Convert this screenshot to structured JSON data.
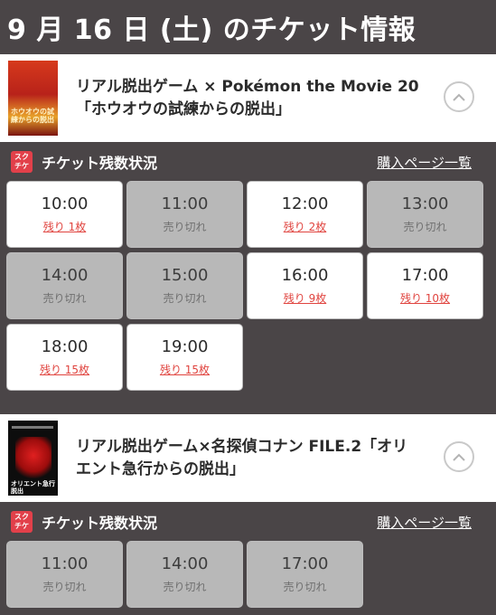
{
  "page": {
    "title": "9 月 16 日 (土) のチケット情報"
  },
  "events": [
    {
      "title": "リアル脱出ゲーム × Pokémon the Movie 20「ホウオウの試練からの脱出」",
      "poster_text": "ホウオウの試練からの脱出",
      "status_title": "チケット残数状況",
      "purchase_link": "購入ページ一覧",
      "slots": [
        {
          "time": "10:00",
          "status": "残り 1枚",
          "available": true
        },
        {
          "time": "11:00",
          "status": "売り切れ",
          "available": false
        },
        {
          "time": "12:00",
          "status": "残り 2枚",
          "available": true
        },
        {
          "time": "13:00",
          "status": "売り切れ",
          "available": false
        },
        {
          "time": "14:00",
          "status": "売り切れ",
          "available": false
        },
        {
          "time": "15:00",
          "status": "売り切れ",
          "available": false
        },
        {
          "time": "16:00",
          "status": "残り 9枚",
          "available": true
        },
        {
          "time": "17:00",
          "status": "残り 10枚",
          "available": true
        },
        {
          "time": "18:00",
          "status": "残り 15枚",
          "available": true
        },
        {
          "time": "19:00",
          "status": "残り 15枚",
          "available": true
        }
      ]
    },
    {
      "title": "リアル脱出ゲーム×名探偵コナン FILE.2「オリエント急行からの脱出」",
      "poster_text": "オリエント急行脱出",
      "status_title": "チケット残数状況",
      "purchase_link": "購入ページ一覧",
      "slots": [
        {
          "time": "11:00",
          "status": "売り切れ",
          "available": false
        },
        {
          "time": "14:00",
          "status": "売り切れ",
          "available": false
        },
        {
          "time": "17:00",
          "status": "売り切れ",
          "available": false
        }
      ]
    }
  ],
  "logo": {
    "line1": "スク",
    "line2": "チケ"
  },
  "colors": {
    "background": "#4a4547",
    "accent": "#e2404a",
    "sold_out": "#b8b8b8",
    "remaining": "#e0443f"
  },
  "icons": {
    "collapse": "chevron-up-icon"
  }
}
